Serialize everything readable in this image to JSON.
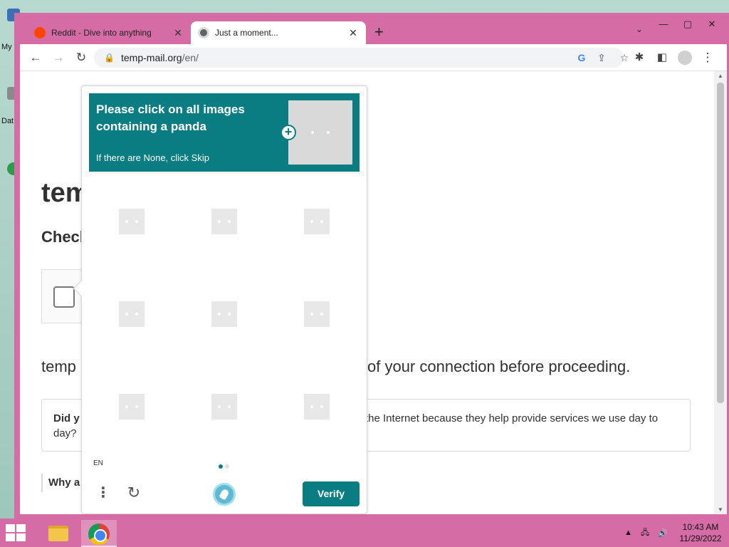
{
  "desktop": {
    "icon_labels": [
      "My",
      "Dat"
    ]
  },
  "tabs": [
    {
      "title": "Reddit - Dive into anything",
      "active": false,
      "icon": "reddit-icon"
    },
    {
      "title": "Just a moment...",
      "active": true,
      "icon": "globe-icon"
    }
  ],
  "toolbar": {
    "url_host": "temp-mail.org",
    "url_path": "/en/"
  },
  "page": {
    "title_partial": "tem",
    "subtitle_partial": "Check",
    "line_left": "temp",
    "line_right": "of your connection before proceeding.",
    "notice_bold_partial": "Did y",
    "notice_right": "the Internet because they help provide services we use day to",
    "notice_line2": "day?",
    "why_partial": "Why a"
  },
  "captcha": {
    "prompt": "Please click on all images containing a panda",
    "hint": "If there are None, click Skip",
    "language": "EN",
    "verify_label": "Verify",
    "grid_rows": 3,
    "grid_cols": 3,
    "page_current": 1,
    "page_total": 2,
    "accent_color": "#0a7d83"
  },
  "taskbar": {
    "time": "10:43 AM",
    "date": "11/29/2022"
  }
}
